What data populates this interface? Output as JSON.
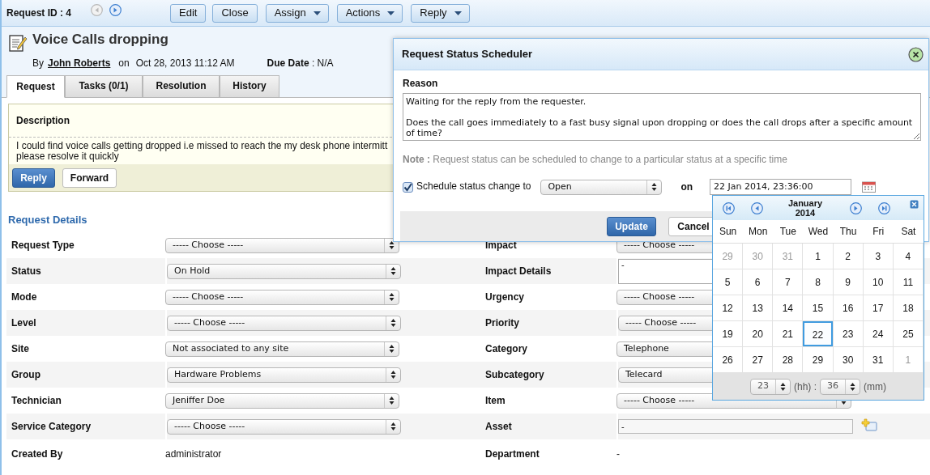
{
  "toolbar": {
    "request_id": "Request ID : 4",
    "nav": [
      {
        "kind": "prev",
        "disabled": true
      },
      {
        "kind": "next",
        "disabled": false
      }
    ],
    "buttons": [
      {
        "label": "Edit",
        "dropdown": false
      },
      {
        "label": "Close",
        "dropdown": false
      },
      {
        "label": "Assign",
        "dropdown": true
      },
      {
        "label": "Actions",
        "dropdown": true
      },
      {
        "label": "Reply",
        "dropdown": true
      }
    ]
  },
  "request": {
    "title": "Voice Calls dropping",
    "by": "By",
    "author": "John Roberts",
    "on": "on",
    "created": "Oct 28, 2013 11:12 AM",
    "due": "**Due Date** : N/A"
  },
  "tabs": [
    {
      "label": "Request",
      "selected": true
    },
    {
      "label": "Tasks (0/1)",
      "selected": false
    },
    {
      "label": "Resolution",
      "selected": false
    },
    {
      "label": "History",
      "selected": false
    }
  ],
  "description": {
    "heading": "Description",
    "lines": [
      "I could find voice calls getting dropped i.e missed to reach the my desk phone intermitt",
      "please resolve it quickly"
    ],
    "buttons": [
      {
        "label": "Reply",
        "primary": true
      },
      {
        "label": "Forward",
        "primary": false
      }
    ]
  },
  "details": {
    "heading": "Request Details",
    "left": [
      {
        "label": "Request Type",
        "kind": "select",
        "value": "----- Choose -----"
      },
      {
        "label": "Status",
        "kind": "select",
        "value": "On Hold"
      },
      {
        "label": "Mode",
        "kind": "select",
        "value": "----- Choose -----"
      },
      {
        "label": "Level",
        "kind": "select",
        "value": "----- Choose -----"
      },
      {
        "label": "Site",
        "kind": "select",
        "value": "Not associated to any site"
      },
      {
        "label": "Group",
        "kind": "select",
        "value": "Hardware Problems"
      },
      {
        "label": "Technician",
        "kind": "select",
        "value": "Jeniffer Doe"
      },
      {
        "label": "Service Category",
        "kind": "select",
        "value": "----- Choose -----"
      },
      {
        "label": "Created By",
        "kind": "text",
        "value": "administrator"
      }
    ],
    "right": [
      {
        "label": "Impact",
        "kind": "select_partial",
        "value": "----- Choose -----"
      },
      {
        "label": "Impact Details",
        "kind": "textarea",
        "value": "-"
      },
      {
        "label": "Urgency",
        "kind": "select_partial",
        "value": "----- Choose -----"
      },
      {
        "label": "Priority",
        "kind": "select_partial",
        "value": "----- Choose -----"
      },
      {
        "label": "Category",
        "kind": "select_partial",
        "value": "Telephone"
      },
      {
        "label": "Subcategory",
        "kind": "select_partial",
        "value": "Telecard"
      },
      {
        "label": "Item",
        "kind": "select",
        "value": "----- Choose -----"
      },
      {
        "label": "Asset",
        "kind": "lookup",
        "value": "-"
      },
      {
        "label": "Department",
        "kind": "text",
        "value": "-"
      }
    ]
  },
  "dialog": {
    "title": "Request Status Scheduler",
    "reason_label": "Reason",
    "reason": "Waiting for the reply from the requester.\n\nDoes the call goes immediately to a fast busy signal upon dropping or does the call drops after a specific amount of time?",
    "note": "**Note :** Request status can be scheduled to change to a particular status at a specific time",
    "schedule": {
      "checked": true,
      "label": "Schedule status change to",
      "status": "Open",
      "on": "on",
      "datetime": "22 Jan 2014, 23:36:00"
    },
    "buttons": [
      {
        "label": "Update",
        "primary": true
      },
      {
        "label": "Cancel",
        "primary": false
      }
    ]
  },
  "calendar": {
    "month": "January",
    "year": "2014",
    "weekdays": [
      "Sun",
      "Mon",
      "Tue",
      "Wed",
      "Thu",
      "Fri",
      "Sat"
    ],
    "weeks": [
      [
        {
          "day": "29",
          "muted": true,
          "selected": false
        },
        {
          "day": "30",
          "muted": true,
          "selected": false
        },
        {
          "day": "31",
          "muted": true,
          "selected": false
        },
        {
          "day": "1",
          "muted": false,
          "selected": false
        },
        {
          "day": "2",
          "muted": false,
          "selected": false
        },
        {
          "day": "3",
          "muted": false,
          "selected": false
        },
        {
          "day": "4",
          "muted": false,
          "selected": false
        }
      ],
      [
        {
          "day": "5",
          "muted": false,
          "selected": false
        },
        {
          "day": "6",
          "muted": false,
          "selected": false
        },
        {
          "day": "7",
          "muted": false,
          "selected": false
        },
        {
          "day": "8",
          "muted": false,
          "selected": false
        },
        {
          "day": "9",
          "muted": false,
          "selected": false
        },
        {
          "day": "10",
          "muted": false,
          "selected": false
        },
        {
          "day": "11",
          "muted": false,
          "selected": false
        }
      ],
      [
        {
          "day": "12",
          "muted": false,
          "selected": false
        },
        {
          "day": "13",
          "muted": false,
          "selected": false
        },
        {
          "day": "14",
          "muted": false,
          "selected": false
        },
        {
          "day": "15",
          "muted": false,
          "selected": false
        },
        {
          "day": "16",
          "muted": false,
          "selected": false
        },
        {
          "day": "17",
          "muted": false,
          "selected": false
        },
        {
          "day": "18",
          "muted": false,
          "selected": false
        }
      ],
      [
        {
          "day": "19",
          "muted": false,
          "selected": false
        },
        {
          "day": "20",
          "muted": false,
          "selected": false
        },
        {
          "day": "21",
          "muted": false,
          "selected": false
        },
        {
          "day": "22",
          "muted": false,
          "selected": true
        },
        {
          "day": "23",
          "muted": false,
          "selected": false
        },
        {
          "day": "24",
          "muted": false,
          "selected": false
        },
        {
          "day": "25",
          "muted": false,
          "selected": false
        }
      ],
      [
        {
          "day": "26",
          "muted": false,
          "selected": false
        },
        {
          "day": "27",
          "muted": false,
          "selected": false
        },
        {
          "day": "28",
          "muted": false,
          "selected": false
        },
        {
          "day": "29",
          "muted": false,
          "selected": false
        },
        {
          "day": "30",
          "muted": false,
          "selected": false
        },
        {
          "day": "31",
          "muted": false,
          "selected": false
        },
        {
          "day": "1",
          "muted": true,
          "selected": false
        }
      ]
    ],
    "hour": "23",
    "hour_unit": "(hh) :",
    "minute": "36",
    "minute_unit": "(mm)"
  }
}
